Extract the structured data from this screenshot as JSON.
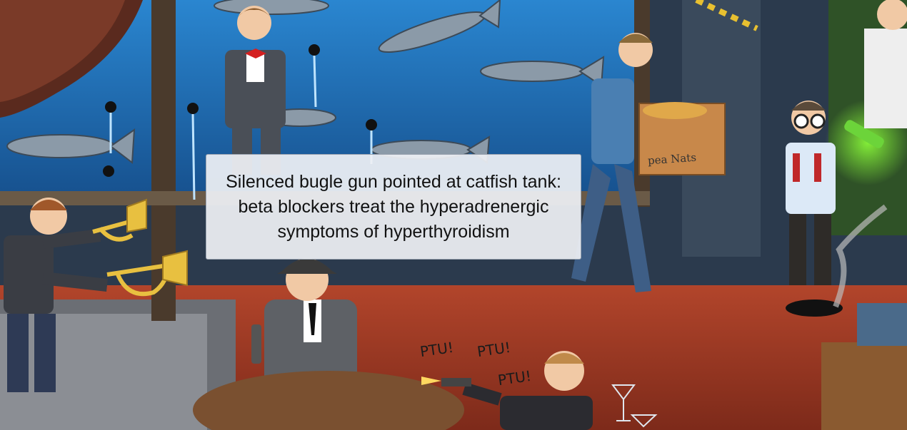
{
  "caption": {
    "text": "Silenced bugle gun pointed at catfish tank: beta blockers treat the hyperadrenergic symptoms of hyperthyroidism"
  },
  "scene_text": {
    "box_label": "pea Nats",
    "sfx": [
      "PTU!",
      "PTU!",
      "PTU!"
    ]
  },
  "colors": {
    "tank_water": "#1f6fb8",
    "floor_red": "#a33a24",
    "wall_dark": "#2f3f52",
    "lab_green": "#3c6a2c"
  }
}
